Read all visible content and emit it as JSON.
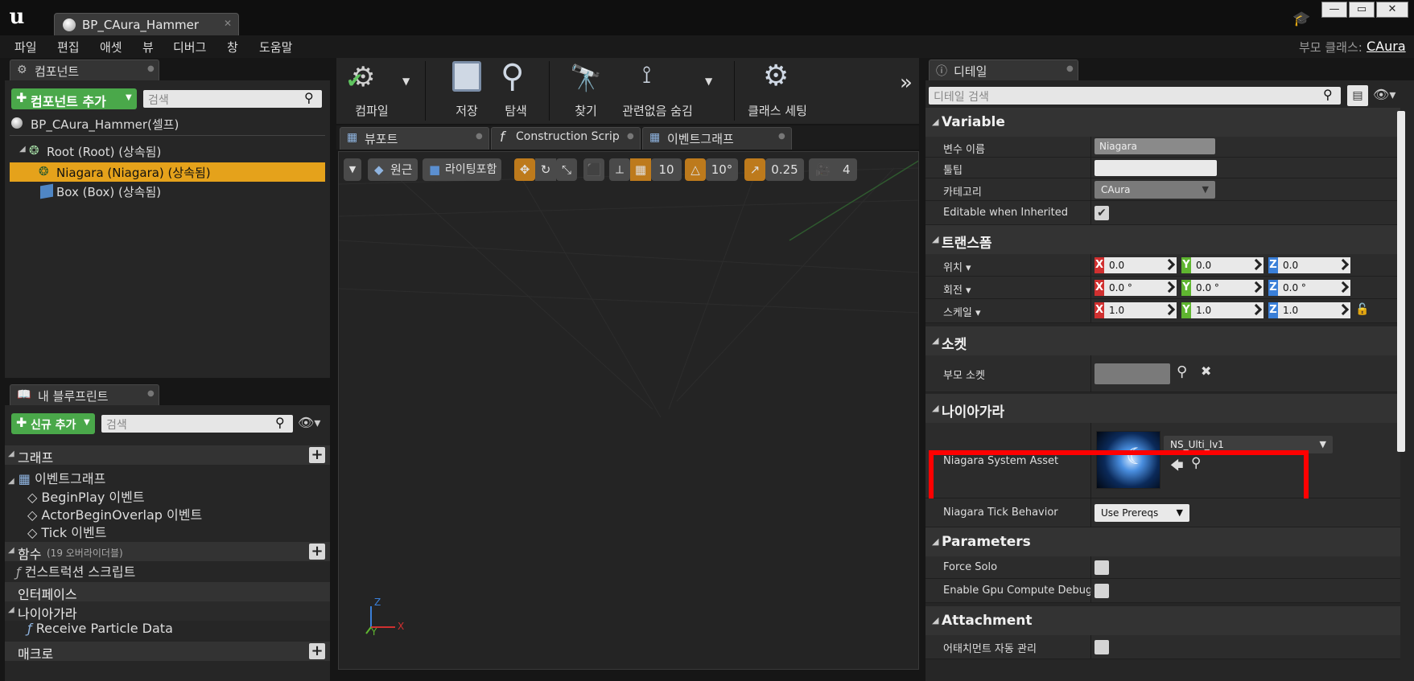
{
  "window": {
    "doc_tab": "BP_CAura_Hammer",
    "parent_class_label": "부모 클래스:",
    "parent_class_value": "CAura"
  },
  "menu": [
    "파일",
    "편집",
    "애셋",
    "뷰",
    "디버그",
    "창",
    "도움말"
  ],
  "components_panel": {
    "tab": "컴포넌트",
    "add_button": "컴포넌트 추가",
    "search_placeholder": "검색",
    "self_item": "BP_CAura_Hammer(셀프)",
    "tree": [
      {
        "label": "Root (Root) (상속됨)"
      },
      {
        "label": "Niagara (Niagara) (상속됨)"
      },
      {
        "label": "Box (Box) (상속됨)"
      }
    ]
  },
  "blueprint_panel": {
    "tab": "내 블루프린트",
    "add_button": "신규 추가",
    "search_placeholder": "검색",
    "graph_category": "그래프",
    "event_graph": "이벤트그래프",
    "events": [
      "BeginPlay 이벤트",
      "ActorBeginOverlap 이벤트",
      "Tick 이벤트"
    ],
    "functions_category": "함수",
    "functions_note": "(19 오버라이더블)",
    "construction_script": "컨스트럭션 스크립트",
    "interfaces_category": "인터페이스",
    "niagara_category": "나이아가라",
    "receive_particle": "Receive Particle Data",
    "macro_category": "매크로"
  },
  "toolbar": {
    "compile": "컴파일",
    "save": "저장",
    "browse": "탐색",
    "find": "찾기",
    "hide_unrelated": "관련없음 숨김",
    "class_settings": "클래스 세팅"
  },
  "viewport": {
    "tabs": [
      "뷰포트",
      "Construction Scrip",
      "이벤트그래프"
    ],
    "perspective": "원근",
    "lighting": "라이팅포함",
    "grid_snap": "10",
    "rot_snap": "10°",
    "scale_snap": "0.25",
    "camera_speed": "4",
    "axis_x": "X",
    "axis_y": "Y",
    "axis_z": "Z"
  },
  "details": {
    "tab": "디테일",
    "search_placeholder": "디테일 검색",
    "variable_section": "Variable",
    "var_name_label": "변수 이름",
    "var_name_value": "Niagara",
    "tooltip_label": "툴팁",
    "category_label": "카테고리",
    "category_value": "CAura",
    "editable_label": "Editable when Inherited",
    "transform_section": "트랜스폼",
    "location_label": "위치",
    "rotation_label": "회전",
    "scale_label": "스케일",
    "location": [
      "0.0",
      "0.0",
      "0.0"
    ],
    "rotation": [
      "0.0 °",
      "0.0 °",
      "0.0 °"
    ],
    "scale": [
      "1.0",
      "1.0",
      "1.0"
    ],
    "socket_section": "소켓",
    "parent_socket_label": "부모 소켓",
    "niagara_section": "나이아가라",
    "system_asset_label": "Niagara System Asset",
    "system_asset_value": "NS_Ulti_lv1",
    "tick_behavior_label": "Niagara Tick Behavior",
    "tick_behavior_value": "Use Prereqs",
    "parameters_section": "Parameters",
    "force_solo_label": "Force Solo",
    "gpu_debug_label": "Enable Gpu Compute Debug",
    "attachment_section": "Attachment",
    "auto_manage_label": "어태치먼트 자동 관리",
    "highlight_color": "#ff0000"
  }
}
